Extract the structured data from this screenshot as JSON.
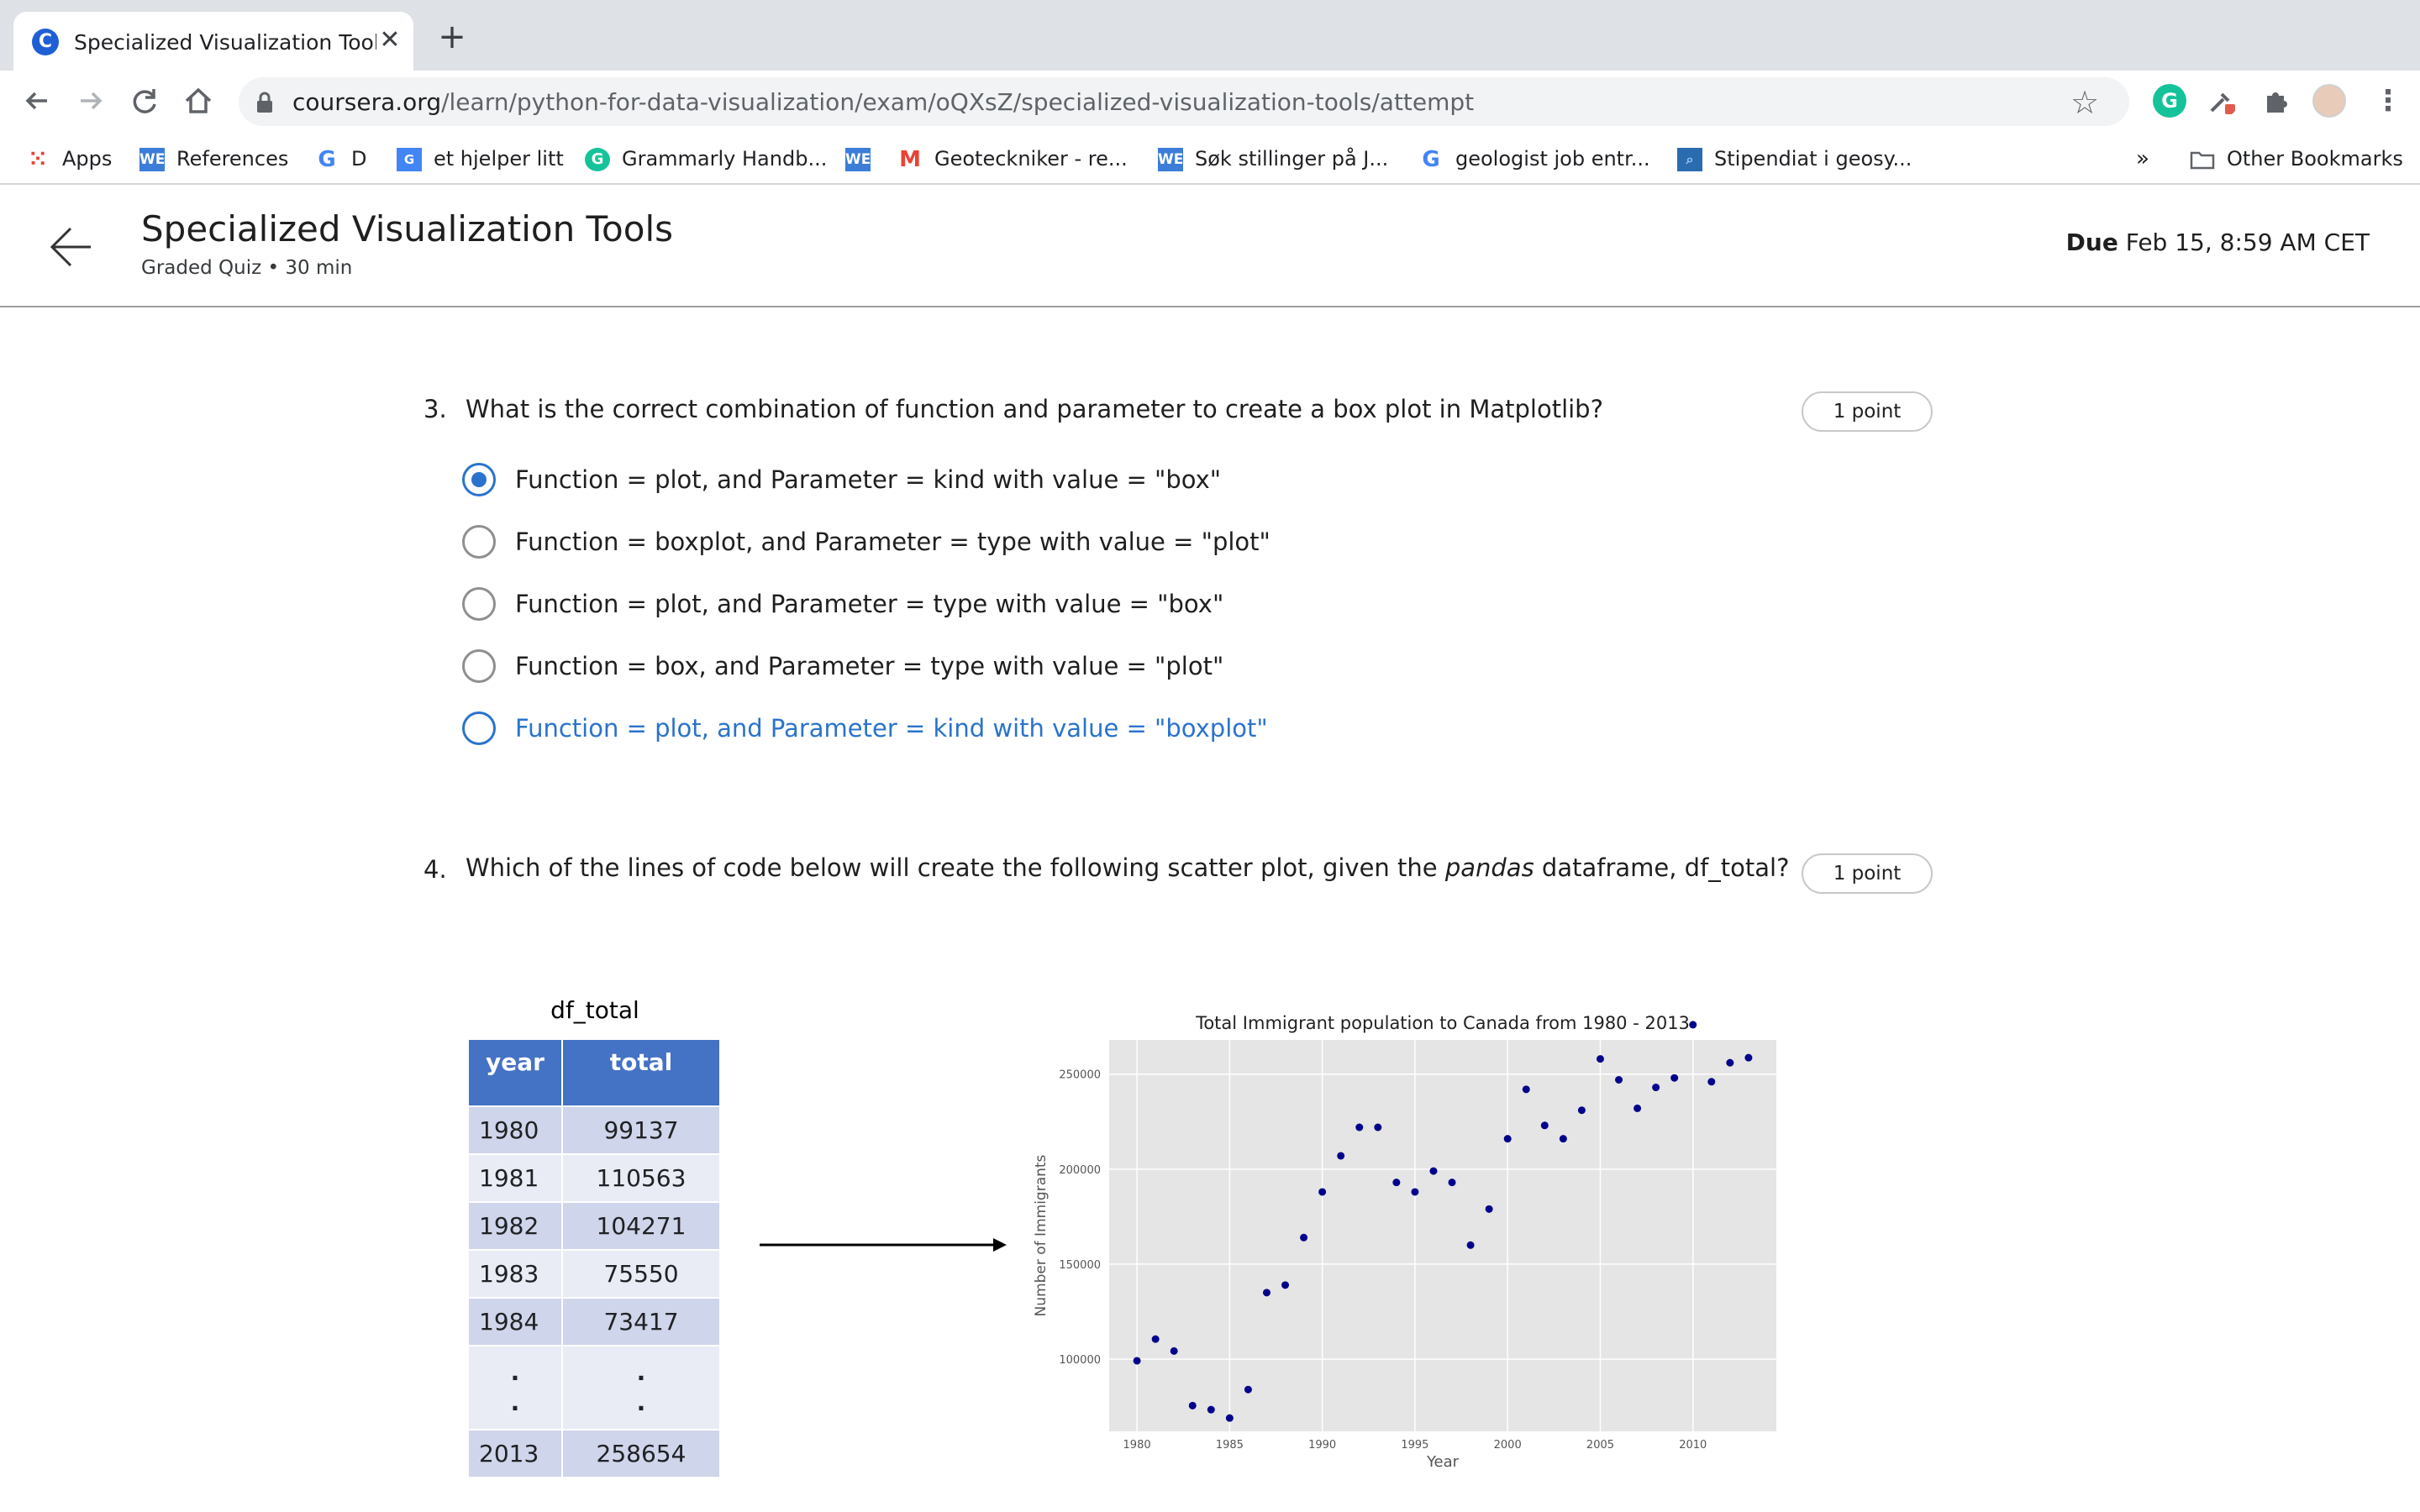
{
  "browser": {
    "tab_title": "Specialized Visualization Tools",
    "tab_close": "✕",
    "new_tab": "+",
    "url_host": "coursera.org",
    "url_path": "/learn/python-for-data-visualization/exam/oQXsZ/specialized-visualization-tools/attempt",
    "bookmarks": {
      "apps": "Apps",
      "references": "References",
      "d": "D",
      "et_hjelper": "et hjelper litt",
      "grammarly": "Grammarly Handb...",
      "geoteckniker": "Geoteckniker - re...",
      "sok": "Søk stillinger på J...",
      "geologist": "geologist job entr...",
      "stipendiat": "Stipendiat i geosy...",
      "more": "»",
      "other": "Other Bookmarks"
    },
    "icon_labels": {
      "we": "WE",
      "g": "G",
      "c": "C",
      "m": "M"
    }
  },
  "header": {
    "title": "Specialized Visualization Tools",
    "subtitle": "Graded Quiz • 30 min",
    "due_label": "Due",
    "due_value": "Feb 15, 8:59 AM CET"
  },
  "q3": {
    "number": "3.",
    "text": "What is the correct combination of function and parameter to create a box plot in Matplotlib?",
    "points": "1 point",
    "options": [
      "Function = plot, and Parameter = kind with value = \"box\"",
      "Function = boxplot, and Parameter = type with value = \"plot\"",
      "Function = plot, and Parameter = type with value = \"box\"",
      "Function = box, and Parameter = type with value = \"plot\"",
      "Function = plot, and Parameter = kind with value = \"boxplot\""
    ],
    "selected_index": 0
  },
  "q4": {
    "number": "4.",
    "text_before": "Which of the lines of code below will create the following scatter plot, given the ",
    "text_em": "pandas",
    "text_after": " dataframe, df_total?",
    "points": "1 point",
    "df": {
      "caption": "df_total",
      "headers": [
        "year",
        "total"
      ],
      "rows": [
        [
          "1980",
          "99137"
        ],
        [
          "1981",
          "110563"
        ],
        [
          "1982",
          "104271"
        ],
        [
          "1983",
          "75550"
        ],
        [
          "1984",
          "73417"
        ],
        [
          ".",
          "."
        ],
        [
          "2013",
          "258654"
        ]
      ]
    }
  },
  "colors": {
    "accent": "#2a73cc",
    "table_header": "#4472c4",
    "scatter": "#00008b",
    "plot_bg": "#e5e5e5"
  },
  "chart_data": {
    "type": "scatter",
    "title": "Total Immigrant population to Canada from 1980 - 2013",
    "xlabel": "Year",
    "ylabel": "Number of Immigrants",
    "xlim": [
      1978.5,
      2014.5
    ],
    "ylim": [
      62000,
      268000
    ],
    "xticks": [
      1980,
      1985,
      1990,
      1995,
      2000,
      2005,
      2010
    ],
    "yticks": [
      100000,
      150000,
      200000,
      250000
    ],
    "grid": true,
    "x": [
      1980,
      1981,
      1982,
      1983,
      1984,
      1985,
      1986,
      1987,
      1988,
      1989,
      1990,
      1991,
      1992,
      1993,
      1994,
      1995,
      1996,
      1997,
      1998,
      1999,
      2000,
      2001,
      2002,
      2003,
      2004,
      2005,
      2006,
      2007,
      2008,
      2009,
      2010,
      2011,
      2012,
      2013
    ],
    "y": [
      99137,
      110563,
      104271,
      75550,
      73417,
      69000,
      84000,
      135000,
      139000,
      164000,
      188000,
      207000,
      222000,
      222000,
      193000,
      188000,
      199000,
      193000,
      160000,
      179000,
      216000,
      242000,
      223000,
      216000,
      231000,
      258000,
      247000,
      232000,
      243000,
      248000,
      276000,
      246000,
      256000,
      258654
    ]
  }
}
